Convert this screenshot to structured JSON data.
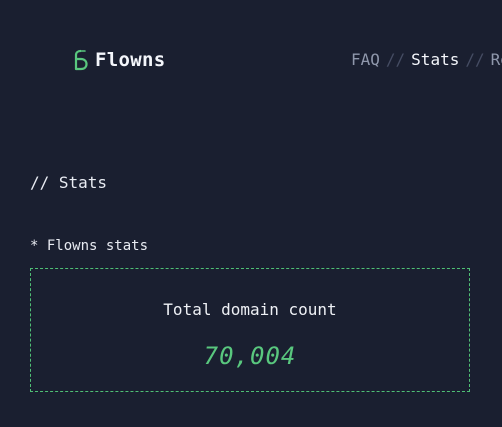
{
  "header": {
    "brand_name": "Flowns",
    "logo_icon": "flowns-logo-icon",
    "nav": [
      {
        "label": "FAQ",
        "active": false
      },
      {
        "label": "Stats",
        "active": true
      },
      {
        "label": "Re",
        "active": false
      }
    ],
    "separator": "//"
  },
  "main": {
    "section_title": "// Stats",
    "subtitle": "* Flowns stats",
    "stat": {
      "label": "Total domain count",
      "value": "70,004"
    }
  },
  "colors": {
    "background": "#1a1f30",
    "accent": "#59c77e",
    "muted_text": "#8f97ab"
  }
}
